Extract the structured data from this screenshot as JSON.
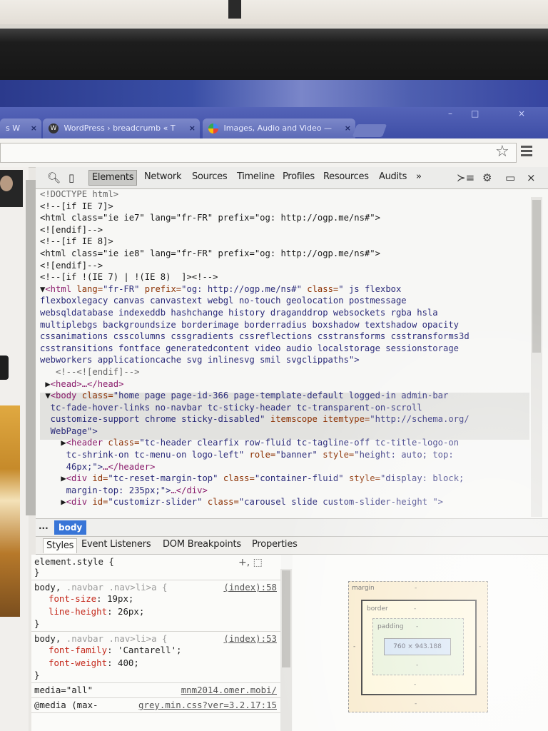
{
  "browser": {
    "tabs": [
      {
        "label": "s W",
        "close": "×"
      },
      {
        "label": "WordPress › breadcrumb « T",
        "close": "×"
      },
      {
        "label": "Images, Audio and Video — ",
        "close": "×"
      }
    ],
    "window_controls": [
      "–",
      "□",
      "×"
    ]
  },
  "devtools": {
    "tabs": [
      "Elements",
      "Network",
      "Sources",
      "Timeline",
      "Profiles",
      "Resources",
      "Audits",
      "»"
    ],
    "active_tab": "Elements",
    "dom_lines": [
      [
        {
          "t": "<!DOCTYPE html>",
          "c": "c-com"
        }
      ],
      [
        {
          "t": "<!--[if IE 7]>",
          "c": "c-plain"
        }
      ],
      [
        {
          "t": "<html class=\"ie ie7\" lang=\"fr-FR\" prefix=\"og: http://ogp.me/ns#\">",
          "c": "c-plain"
        }
      ],
      [
        {
          "t": "<![endif]-->",
          "c": "c-plain"
        }
      ],
      [
        {
          "t": "<!--[if IE 8]>",
          "c": "c-plain"
        }
      ],
      [
        {
          "t": "<html class=\"ie ie8\" lang=\"fr-FR\" prefix=\"og: http://ogp.me/ns#\">",
          "c": "c-plain"
        }
      ],
      [
        {
          "t": "<![endif]-->",
          "c": "c-plain"
        }
      ],
      [
        {
          "t": "<!--[if !(IE 7) | !(IE 8)  ]><!-->",
          "c": "c-plain"
        }
      ],
      [
        {
          "t": "▼",
          "c": "c-plain"
        },
        {
          "t": "<html ",
          "c": "c-tag"
        },
        {
          "t": "lang=",
          "c": "c-attr"
        },
        {
          "t": "\"fr-FR\" ",
          "c": "c-val"
        },
        {
          "t": "prefix=",
          "c": "c-attr"
        },
        {
          "t": "\"og: http://ogp.me/ns#\" ",
          "c": "c-val"
        },
        {
          "t": "class=",
          "c": "c-attr"
        },
        {
          "t": "\" js flexbox",
          "c": "c-val"
        }
      ],
      [
        {
          "t": "flexboxlegacy canvas canvastext webgl no-touch geolocation postmessage",
          "c": "c-val"
        }
      ],
      [
        {
          "t": "websqldatabase indexeddb hashchange history draganddrop websockets rgba hsla",
          "c": "c-val"
        }
      ],
      [
        {
          "t": "multiplebgs backgroundsize borderimage borderradius boxshadow textshadow opacity",
          "c": "c-val"
        }
      ],
      [
        {
          "t": "cssanimations csscolumns cssgradients cssreflections csstransforms csstransforms3d",
          "c": "c-val"
        }
      ],
      [
        {
          "t": "csstransitions fontface generatedcontent video audio localstorage sessionstorage",
          "c": "c-val"
        }
      ],
      [
        {
          "t": "webworkers applicationcache svg inlinesvg smil svgclippaths\">",
          "c": "c-val"
        }
      ],
      [
        {
          "t": "   <!--<![endif]-->",
          "c": "c-com"
        }
      ],
      [
        {
          "t": " ▶",
          "c": "c-plain"
        },
        {
          "t": "<head>…</head>",
          "c": "c-tag"
        }
      ],
      [
        {
          "t": " ▼",
          "c": "c-plain"
        },
        {
          "t": "<body ",
          "c": "c-tag"
        },
        {
          "t": "class=",
          "c": "c-attr"
        },
        {
          "t": "\"home page page-id-366 page-template-default logged-in admin-bar",
          "c": "c-val"
        }
      ],
      [
        {
          "t": "  tc-fade-hover-links no-navbar tc-sticky-header tc-transparent-on-scroll",
          "c": "c-val"
        }
      ],
      [
        {
          "t": "  customize-support chrome sticky-disabled\" ",
          "c": "c-val"
        },
        {
          "t": "itemscope itemtype=",
          "c": "c-attr"
        },
        {
          "t": "\"http://schema.org/",
          "c": "c-val"
        }
      ],
      [
        {
          "t": "  WebPage\">",
          "c": "c-val"
        }
      ],
      [
        {
          "t": "    ▶",
          "c": "c-plain"
        },
        {
          "t": "<header ",
          "c": "c-tag"
        },
        {
          "t": "class=",
          "c": "c-attr"
        },
        {
          "t": "\"tc-header clearfix row-fluid tc-tagline-off tc-title-logo-on",
          "c": "c-val"
        }
      ],
      [
        {
          "t": "     tc-shrink-on tc-menu-on logo-left\" ",
          "c": "c-val"
        },
        {
          "t": "role=",
          "c": "c-attr"
        },
        {
          "t": "\"banner\" ",
          "c": "c-val"
        },
        {
          "t": "style=",
          "c": "c-attr"
        },
        {
          "t": "\"height: auto; top:",
          "c": "c-val"
        }
      ],
      [
        {
          "t": "     46px;\">",
          "c": "c-val"
        },
        {
          "t": "…</header>",
          "c": "c-tag"
        }
      ],
      [
        {
          "t": "    ▶",
          "c": "c-plain"
        },
        {
          "t": "<div ",
          "c": "c-tag"
        },
        {
          "t": "id=",
          "c": "c-attr"
        },
        {
          "t": "\"tc-reset-margin-top\" ",
          "c": "c-val"
        },
        {
          "t": "class=",
          "c": "c-attr"
        },
        {
          "t": "\"container-fluid\" ",
          "c": "c-val"
        },
        {
          "t": "style=",
          "c": "c-attr"
        },
        {
          "t": "\"display: block;",
          "c": "c-val"
        }
      ],
      [
        {
          "t": "     margin-top: 235px;\">",
          "c": "c-val"
        },
        {
          "t": "…</div>",
          "c": "c-tag"
        }
      ],
      [
        {
          "t": "    ▶",
          "c": "c-plain"
        },
        {
          "t": "<div ",
          "c": "c-tag"
        },
        {
          "t": "id=",
          "c": "c-attr"
        },
        {
          "t": "\"customizr-slider\" ",
          "c": "c-val"
        },
        {
          "t": "class=",
          "c": "c-attr"
        },
        {
          "t": "\"carousel slide custom-slider-height \">",
          "c": "c-val"
        }
      ]
    ],
    "breadcrumb": {
      "more": "...",
      "current": "body"
    },
    "sub_tabs": [
      "Styles",
      "Event Listeners",
      "DOM Breakpoints",
      "Properties"
    ],
    "active_sub_tab": "Styles",
    "style_rules": [
      {
        "selector": "element.style {",
        "selector_dim": "",
        "source": "",
        "props": [],
        "close": "}"
      },
      {
        "selector": "body, ",
        "selector_dim": ".navbar .nav>li>a {",
        "source": "(index):58",
        "props": [
          {
            "name": "font-size",
            "value": "19px;"
          },
          {
            "name": "line-height",
            "value": "26px;"
          }
        ],
        "close": "}"
      },
      {
        "selector": "body, ",
        "selector_dim": ".navbar .nav>li>a {",
        "source": "(index):53",
        "props": [
          {
            "name": "font-family",
            "value": "'Cantarell';"
          },
          {
            "name": "font-weight",
            "value": "400;"
          }
        ],
        "close": "}"
      },
      {
        "selector": "media=\"all\"",
        "selector_dim": "",
        "source": "mnm2014.omer.mobi/",
        "props": [],
        "close": ""
      },
      {
        "selector": "@media (max-",
        "selector_dim": "",
        "source": "grey.min.css?ver=3.2.17:15",
        "props": [],
        "close": ""
      }
    ],
    "metrics": {
      "margin_label": "margin",
      "margin_value": "-",
      "border_label": "border",
      "border_value": "-",
      "padding_label": "padding",
      "padding_value": "-",
      "content_size": "760 × 943.188"
    }
  }
}
